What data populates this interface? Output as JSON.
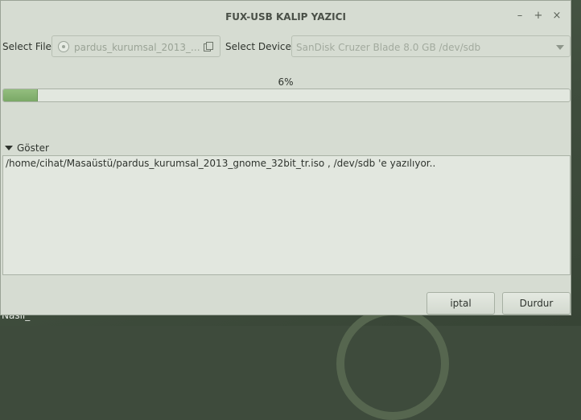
{
  "window": {
    "title": "FUX-USB KALIP YAZICI",
    "controls": {
      "minimize": "–",
      "maximize": "+",
      "close": "×"
    }
  },
  "file": {
    "label": "Select File",
    "value": "pardus_kurumsal_2013_..."
  },
  "device": {
    "label": "Select Device",
    "value": "SanDisk Cruzer Blade 8.0 GB /dev/sdb"
  },
  "progress": {
    "text": "6%",
    "fraction": 0.06
  },
  "log": {
    "expander_label": "Göster",
    "text": "/home/cihat/Masaüstü/pardus_kurumsal_2013_gnome_32bit_tr.iso , /dev/sdb 'e yazılıyor.."
  },
  "buttons": {
    "cancel": "iptal",
    "stop": "Durdur"
  },
  "desktop": {
    "text": "Nasıl_"
  },
  "colors": {
    "accent_green": "#7aa866",
    "window_bg": "#d6dcd2",
    "desktop_bg": "#3f4d3d"
  }
}
